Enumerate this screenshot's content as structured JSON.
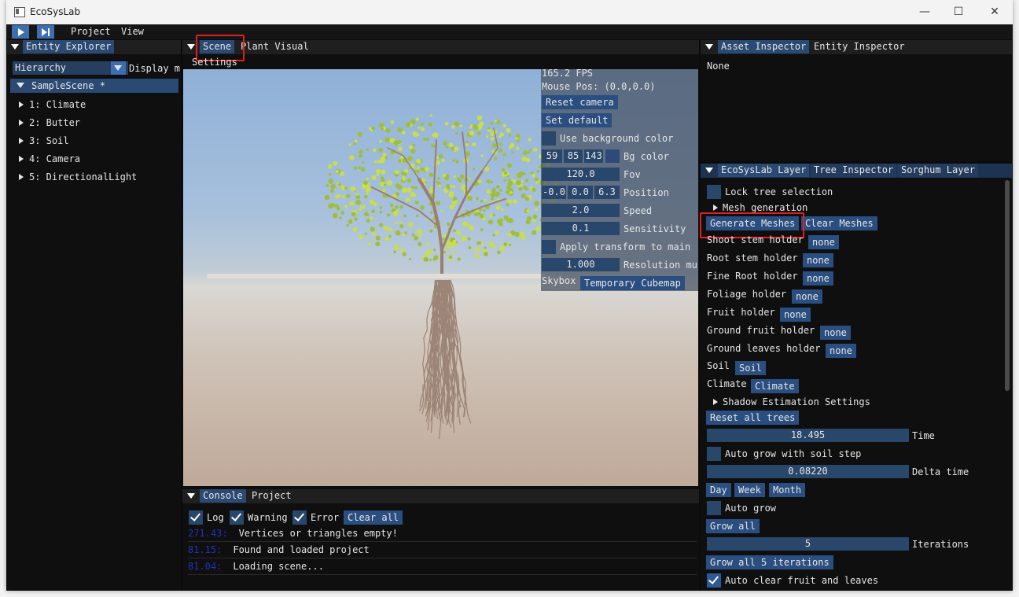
{
  "window": {
    "title": "EcoSysLab",
    "minimize": "—",
    "maximize": "☐",
    "close": "✕"
  },
  "menu": {
    "items": [
      "Project",
      "View"
    ],
    "play_icon": "play-icon",
    "step_icon": "step-icon"
  },
  "entity_explorer": {
    "tab": "Entity Explorer",
    "mode_select": "Hierarchy",
    "display_label": "Display m",
    "scene": "SampleScene *",
    "entities": [
      "1: Climate",
      "2: Butter",
      "3: Soil",
      "4: Camera",
      "5: DirectionalLight"
    ]
  },
  "scene_panel": {
    "tabs": [
      "Scene",
      "Plant Visual"
    ],
    "settings": "Settings",
    "fps": "165.2 FPS",
    "mouse_pos": "Mouse Pos: (0.0,0.0)",
    "reset_camera": "Reset camera",
    "set_default": "Set default",
    "use_bg_color": "Use background color",
    "bg_r": "59",
    "bg_g": "85",
    "bg_b": "143",
    "bg_color_label": "Bg color",
    "bg_swatch": "#2e4a7a",
    "fov": "120.0",
    "fov_label": "Fov",
    "pos_x": "-0.0",
    "pos_y": "0.0",
    "pos_z": "6.3",
    "position_label": "Position",
    "speed": "2.0",
    "speed_label": "Speed",
    "sensitivity": "0.1",
    "sensitivity_label": "Sensitivity",
    "apply_transform": "Apply transform to main c",
    "resolution": "1.000",
    "resolution_label": "Resolution mul",
    "skybox_label": "Skybox",
    "skybox_value": "Temporary Cubemap"
  },
  "console": {
    "tabs": [
      "Console",
      "Project"
    ],
    "log": "Log",
    "warning": "Warning",
    "error": "Error",
    "clear_all": "Clear all",
    "entries": [
      {
        "time": "271.43:",
        "msg": "Vertices or triangles empty!"
      },
      {
        "time": "81.15:",
        "msg": "Found and loaded project"
      },
      {
        "time": "81.04:",
        "msg": "Loading scene..."
      }
    ]
  },
  "inspector": {
    "tabs": [
      "Asset Inspector",
      "Entity Inspector"
    ],
    "value": "None"
  },
  "ecosys": {
    "tabs": [
      "EcoSysLab Layer",
      "Tree Inspector",
      "Sorghum Layer"
    ],
    "lock_tree": "Lock tree selection",
    "mesh_generation": "Mesh generation",
    "generate_meshes": "Generate Meshes",
    "clear_meshes": "Clear Meshes",
    "holders": [
      {
        "label": "Shoot stem holder",
        "value": "none"
      },
      {
        "label": "Root stem holder",
        "value": "none"
      },
      {
        "label": "Fine Root holder",
        "value": "none"
      },
      {
        "label": "Foliage holder",
        "value": "none"
      },
      {
        "label": "Fruit holder",
        "value": "none"
      },
      {
        "label": "Ground fruit holder",
        "value": "none"
      },
      {
        "label": "Ground leaves holder",
        "value": "none"
      }
    ],
    "soil_label": "Soil",
    "soil_value": "Soil",
    "climate_label": "Climate",
    "climate_value": "Climate",
    "shadow_settings": "Shadow Estimation Settings",
    "reset_all": "Reset all trees",
    "time": "18.495",
    "time_label": "Time",
    "auto_grow_soil": "Auto grow with soil step",
    "delta_time": "0.08220",
    "delta_label": "Delta time",
    "day": "Day",
    "week": "Week",
    "month": "Month",
    "auto_grow": "Auto grow",
    "grow_all": "Grow all",
    "iterations": "5",
    "iterations_label": "Iterations",
    "grow_iterations": "Grow all 5 iterations",
    "auto_clear": "Auto clear fruit and leaves"
  }
}
